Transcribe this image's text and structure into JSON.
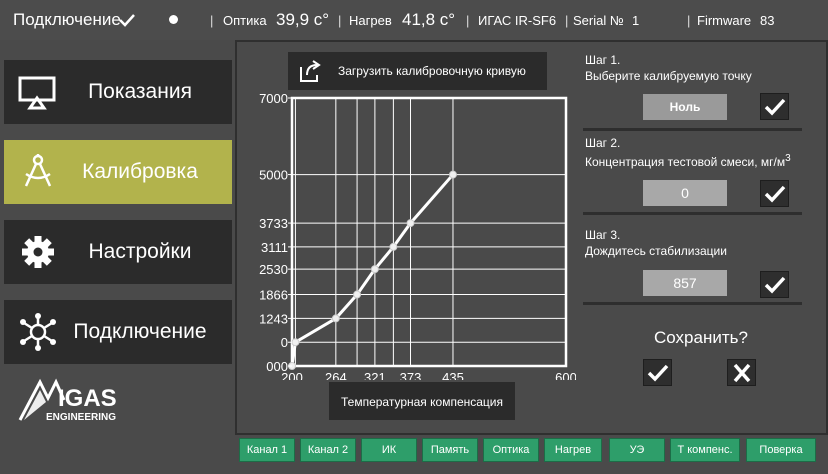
{
  "status": {
    "connection_label": "Подключение",
    "optika_label": "Оптика",
    "optika_value": "39,9 c°",
    "nagrev_label": "Нагрев",
    "nagrev_value": "41,8 c°",
    "device": "ИГАС IR-SF6",
    "serial_label": "Serial №",
    "serial_value": "1",
    "firmware_label": "Firmware",
    "firmware_value": "83"
  },
  "nav": {
    "items": [
      {
        "label": "Показания",
        "icon": "monitor-icon"
      },
      {
        "label": "Калибровка",
        "icon": "compass-icon"
      },
      {
        "label": "Настройки",
        "icon": "gear-icon"
      },
      {
        "label": "Подключение",
        "icon": "network-icon"
      }
    ],
    "active": 1
  },
  "logo": {
    "line1": "IGAS",
    "line2": "ENGINEERING"
  },
  "load_button": {
    "label": "Загрузить калибровочную кривую",
    "icon": "export-icon"
  },
  "temp_button": {
    "label": "Температурная компенсация"
  },
  "steps": {
    "step1": {
      "title": "Шаг 1.",
      "desc": "Выберите калибруемую точку",
      "value": "Ноль"
    },
    "step2": {
      "title": "Шаг 2.",
      "desc": "Концентрация тестовой смеси, мг/м",
      "sup": "3",
      "value": "0"
    },
    "step3": {
      "title": "Шаг 3.",
      "desc": "Дождитесь стабилизации",
      "value": "857"
    }
  },
  "save": {
    "title": "Сохранить?",
    "confirm_icon": "check-icon",
    "cancel_icon": "close-icon"
  },
  "tabs": [
    "Канал 1",
    "Канал 2",
    "ИК",
    "Память",
    "Оптика",
    "Нагрев",
    "УЭ",
    "Т компенс.",
    "Поверка"
  ],
  "chart_data": {
    "type": "line",
    "x_ticks": [
      "200",
      "264",
      "321",
      "373",
      "435",
      "600"
    ],
    "y_ticks": [
      "000",
      "0",
      "1243",
      "1866",
      "2530",
      "3111",
      "3733",
      "5000",
      "7000"
    ],
    "x": [
      200,
      205,
      264,
      295,
      321,
      348,
      373,
      435
    ],
    "y": [
      0,
      621,
      1243,
      1866,
      2530,
      3111,
      3733,
      5000
    ],
    "xlim": [
      200,
      600
    ],
    "ylim": [
      0,
      7000
    ],
    "grid": true,
    "colors": {
      "line": "#ffffff",
      "point": "#f0f0f0",
      "accent": "#b2b34c",
      "tab": "#2e9e6a"
    }
  }
}
